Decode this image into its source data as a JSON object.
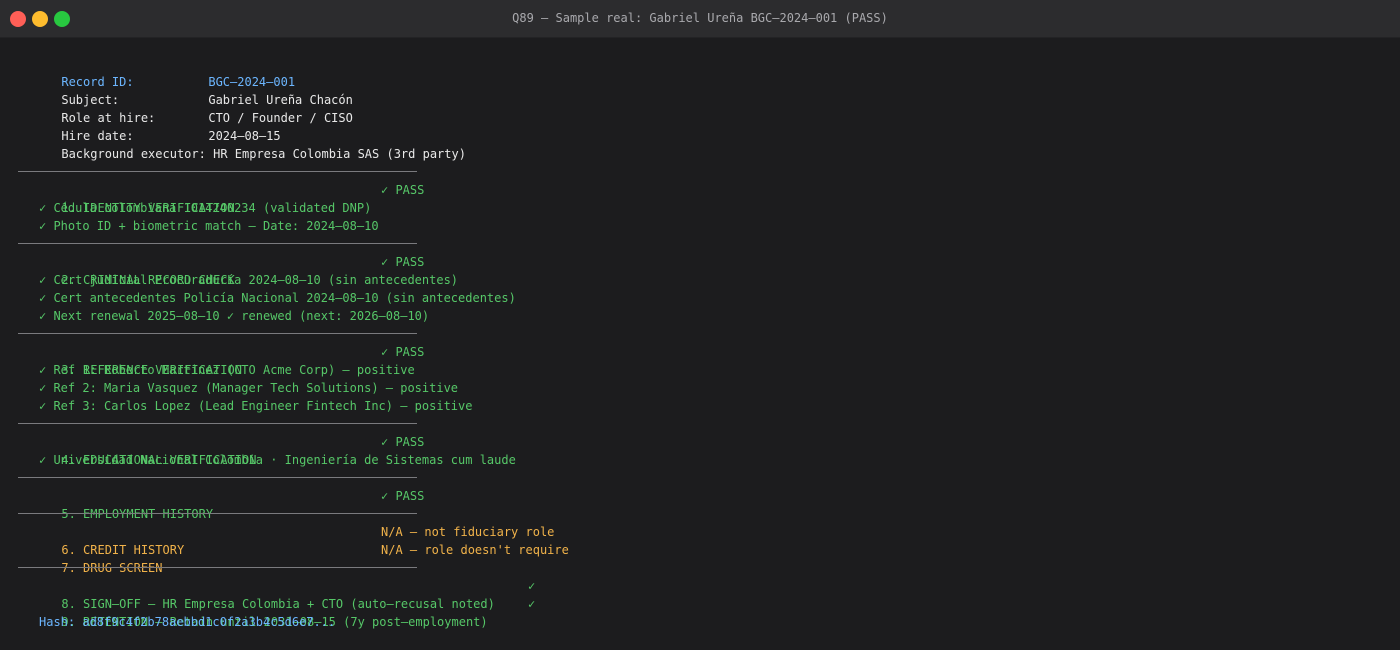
{
  "window": {
    "title": "Q89 — Sample real: Gabriel Ureña BGC–2024–001 (PASS)"
  },
  "header": {
    "record_id_label": "Record ID:",
    "record_id_value": "BGC–2024–001",
    "subject_label": "Subject:",
    "subject_value": "Gabriel Ureña Chacón",
    "role_label": "Role at hire:",
    "role_value": "CTO / Founder / CISO",
    "hire_date_label": "Hire date:",
    "hire_date_value": "2024–08–15",
    "executor_label": "Background executor:",
    "executor_value": "HR Empresa Colombia SAS (3rd party)"
  },
  "sections": {
    "identity": {
      "title": "1. IDENTITY VERIFICATION",
      "status": "✓ PASS",
      "items": [
        "✓ Cédula colombiana 1014240234 (validated DNP)",
        "✓ Photo ID + biometric match — Date: 2024–08–10"
      ]
    },
    "criminal": {
      "title": "2. CRIMINAL RECORD CHECK",
      "status": "✓ PASS",
      "items": [
        "✓ Cert judicial Procuraduría 2024–08–10 (sin antecedentes)",
        "✓ Cert antecedentes Policía Nacional 2024–08–10 (sin antecedentes)",
        "✓ Next renewal 2025–08–10 ✓ renewed (next: 2026–08–10)"
      ]
    },
    "reference": {
      "title": "3. REFERENCE VERIFICATION",
      "status": "✓ PASS",
      "items": [
        "✓ Ref 1: Roberto Martinez (CTO Acme Corp) — positive",
        "✓ Ref 2: Maria Vasquez (Manager Tech Solutions) — positive",
        "✓ Ref 3: Carlos Lopez (Lead Engineer Fintech Inc) — positive"
      ]
    },
    "education": {
      "title": "4. EDUCATIONAL VERIFICATION",
      "status": "✓ PASS",
      "items": [
        "✓ Universidad Nacional Colombia · Ingeniería de Sistemas cum laude"
      ]
    },
    "employment": {
      "title": "5. EMPLOYMENT HISTORY",
      "status": "✓ PASS"
    },
    "credit": {
      "title": "6. CREDIT HISTORY",
      "status": "N/A — not fiduciary role"
    },
    "drug": {
      "title": "7. DRUG SCREEN",
      "status": "N/A — role doesn't require"
    },
    "signoff": {
      "title": "8. SIGN–OFF — HR Empresa Colombia + CTO (auto–recusal noted)",
      "status": "✓"
    },
    "retention": {
      "title": "9. RETENTION — Retain until 2031–08–15 (7y post–employment)",
      "status": "✓",
      "hash": "Hash: ad8f9c4f2b78aebbd1c0f2a3b4c5d6e7..."
    }
  },
  "colors": {
    "background": "#1c1c1e",
    "label_blue": "#6cb6ff",
    "pass_green": "#56c768",
    "na_orange": "#f0b24a"
  }
}
